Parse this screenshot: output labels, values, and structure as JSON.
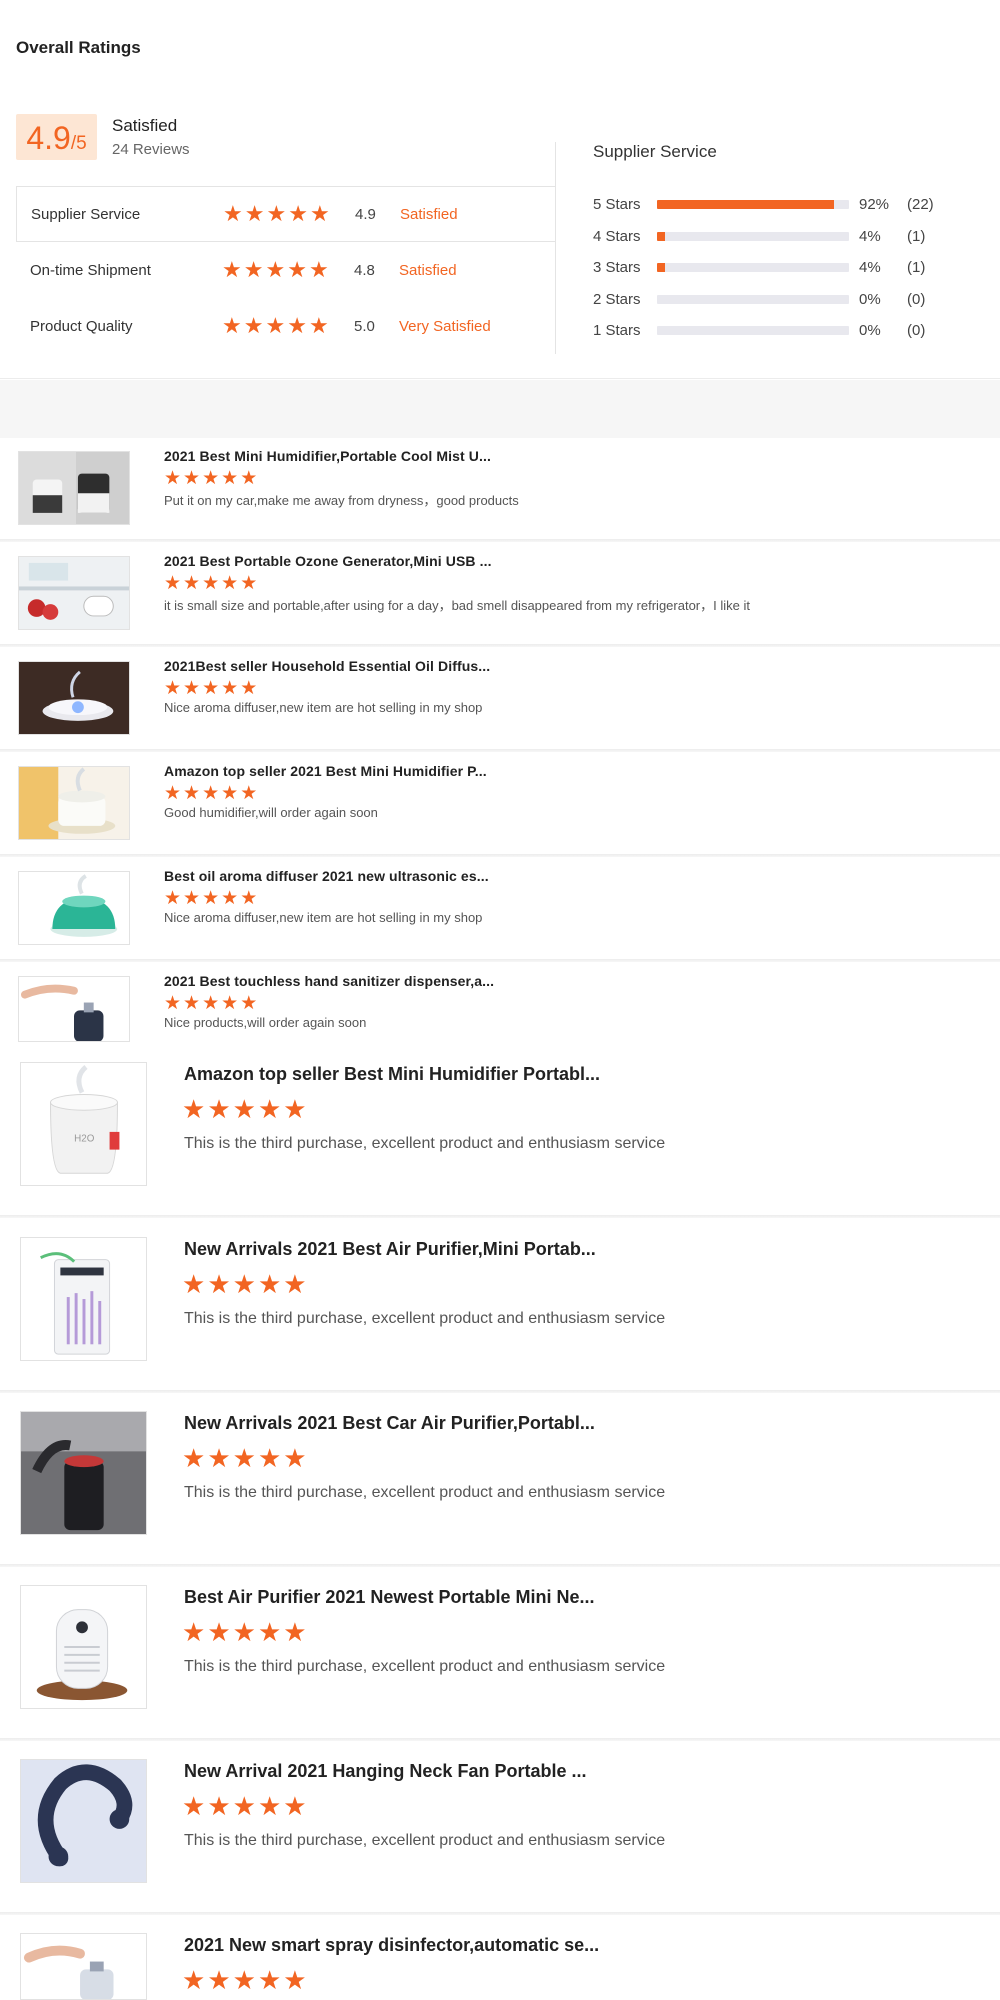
{
  "heading": "Overall Ratings",
  "summary": {
    "score": "4.9",
    "score_suffix": "/5",
    "label": "Satisfied",
    "reviews": "24 Reviews",
    "rating_value": 4.9
  },
  "metrics": [
    {
      "name": "Supplier Service",
      "stars": 5,
      "value": "4.9",
      "verdict": "Satisfied"
    },
    {
      "name": "On-time Shipment",
      "stars": 5,
      "value": "4.8",
      "verdict": "Satisfied"
    },
    {
      "name": "Product Quality",
      "stars": 5,
      "value": "5.0",
      "verdict": "Very Satisfied"
    }
  ],
  "distribution": {
    "title": "Supplier Service",
    "rows": [
      {
        "label": "5 Stars",
        "pct": "92%",
        "count": "(22)",
        "fraction": 0.92
      },
      {
        "label": "4 Stars",
        "pct": "4%",
        "count": "(1)",
        "fraction": 0.04
      },
      {
        "label": "3 Stars",
        "pct": "4%",
        "count": "(1)",
        "fraction": 0.04
      },
      {
        "label": "2 Stars",
        "pct": "0%",
        "count": "(0)",
        "fraction": 0
      },
      {
        "label": "1 Stars",
        "pct": "0%",
        "count": "(0)",
        "fraction": 0
      }
    ]
  },
  "reviews": [
    {
      "title": "2021 Best Mini Humidifier,Portable Cool Mist U...",
      "stars": 5,
      "comment": "Put it on my car,make me away from dryness，good products",
      "thumb": "humidifier-duo"
    },
    {
      "title": "2021 Best Portable Ozone Generator,Mini USB ...",
      "stars": 5,
      "comment": "it is small size and portable,after using for a day，bad smell disappeared from my refrigerator，I like it",
      "thumb": "fridge-ozone"
    },
    {
      "title": "2021Best seller Household Essential Oil Diffus...",
      "stars": 5,
      "comment": "Nice aroma diffuser,new item are hot selling in my shop",
      "thumb": "oil-diffuser"
    },
    {
      "title": "Amazon top seller 2021 Best Mini Humidifier P...",
      "stars": 5,
      "comment": "Good humidifier,will order again soon",
      "thumb": "mini-humidifier"
    },
    {
      "title": "Best oil aroma diffuser 2021 new ultrasonic es...",
      "stars": 5,
      "comment": "Nice aroma diffuser,new item are hot selling in my shop",
      "thumb": "green-diffuser"
    },
    {
      "title": "2021 Best touchless hand sanitizer dispenser,a...",
      "stars": 5,
      "comment": "Nice products,will order again soon",
      "thumb": "sanitizer-dispenser"
    },
    {
      "title": "Amazon top seller Best Mini Humidifier Portabl...",
      "stars": 5,
      "comment": "This is the third purchase, excellent product and enthusiasm service",
      "thumb": "white-humidifier"
    },
    {
      "title": "New Arrivals 2021 Best Air Purifier,Mini Portab...",
      "stars": 5,
      "comment": "This is the third purchase, excellent product and enthusiasm service",
      "thumb": "air-purifier"
    },
    {
      "title": "New Arrivals 2021 Best Car Air Purifier,Portabl...",
      "stars": 5,
      "comment": "This is the third purchase, excellent product and enthusiasm service",
      "thumb": "car-purifier"
    },
    {
      "title": "Best Air Purifier 2021 Newest Portable Mini Ne...",
      "stars": 5,
      "comment": "This is the third purchase, excellent product and enthusiasm service",
      "thumb": "wood-purifier"
    },
    {
      "title": "New Arrival 2021 Hanging Neck Fan Portable ...",
      "stars": 5,
      "comment": "This is the third purchase, excellent product and enthusiasm service",
      "thumb": "neck-fan"
    },
    {
      "title": "2021 New smart spray disinfector,automatic se...",
      "stars": 5,
      "comment": "",
      "thumb": "spray-disinfector"
    }
  ],
  "colors": {
    "accent": "#f26522",
    "badge_bg": "#fde6d4",
    "track": "#e8e8ee"
  }
}
